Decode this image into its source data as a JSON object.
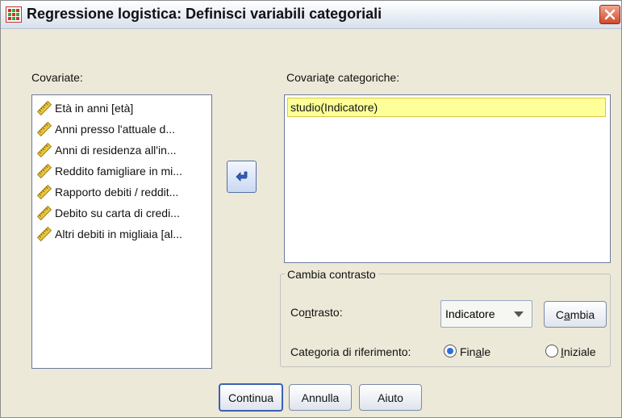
{
  "window": {
    "title": "Regressione logistica: Definisci variabili categoriali"
  },
  "covariates": {
    "label": "Covariate:",
    "items": [
      "Età in anni [età]",
      "Anni presso l'attuale d...",
      "Anni di residenza all'in...",
      "Reddito famigliare in mi...",
      "Rapporto debiti / reddit...",
      "Debito su carta di credi...",
      "Altri debiti in migliaia [al..."
    ]
  },
  "categorical": {
    "label": "Covariate categoriche:",
    "items": [
      "studio(Indicatore)"
    ]
  },
  "contrast_group": {
    "legend": "Cambia contrasto",
    "contrast_label": "Contrasto:",
    "contrast_value": "Indicatore",
    "change_button": "Cambia",
    "reference_label": "Categoria di riferimento:",
    "options": [
      {
        "label": "Finale",
        "selected": true
      },
      {
        "label": "Iniziale",
        "selected": false
      }
    ]
  },
  "buttons": {
    "continue": "Continua",
    "cancel": "Annulla",
    "help": "Aiuto"
  },
  "icons": {
    "variable_icon": "ruler-icon",
    "move_icon": "left-arrow-icon",
    "close_icon": "close-icon"
  },
  "colors": {
    "selection": "#ffff99",
    "close": "#d04a2a",
    "accent": "#3b61b5"
  }
}
